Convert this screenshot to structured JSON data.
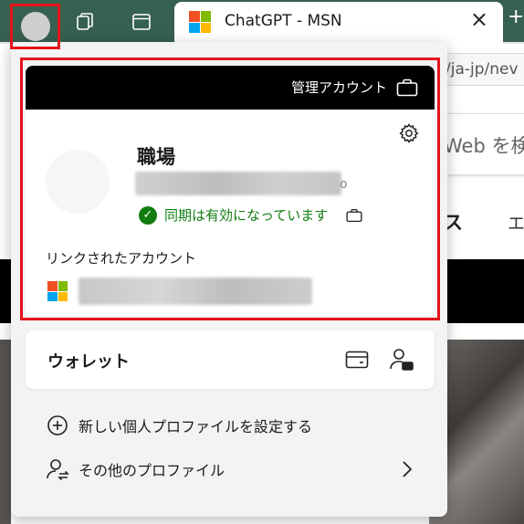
{
  "browser": {
    "tab": {
      "title": "ChatGPT - MSN",
      "close_glyph": "×",
      "favicon": "msn-logo-icon"
    },
    "new_tab_glyph": "+",
    "address_fragment": "/ja-jp/nev",
    "page": {
      "search_fragment": "Web を検",
      "nav_fragment_1": "ス",
      "nav_fragment_2": "エ"
    }
  },
  "profile_flyout": {
    "work_account": {
      "header_label": "管理アカウント",
      "header_icon": "briefcase-icon",
      "settings_icon": "gear-icon",
      "name": "職場",
      "email_tail": "o",
      "sync_status": "同期は有効になっています",
      "sync_color": "#107c10",
      "linked_accounts_label": "リンクされたアカウント",
      "linked_icon": "microsoft-logo-icon"
    },
    "wallet": {
      "label": "ウォレット",
      "icons": [
        "credit-card-icon",
        "person-card-icon"
      ]
    },
    "menu": {
      "new_profile": "新しい個人プロファイルを設定する",
      "other_profiles": "その他のプロファイル"
    }
  },
  "colors": {
    "highlight": "#e5141a",
    "tabbar": "#36604f",
    "ms_red": "#f25022",
    "ms_green": "#7fba00",
    "ms_blue": "#00a4ef",
    "ms_yellow": "#ffb900"
  }
}
